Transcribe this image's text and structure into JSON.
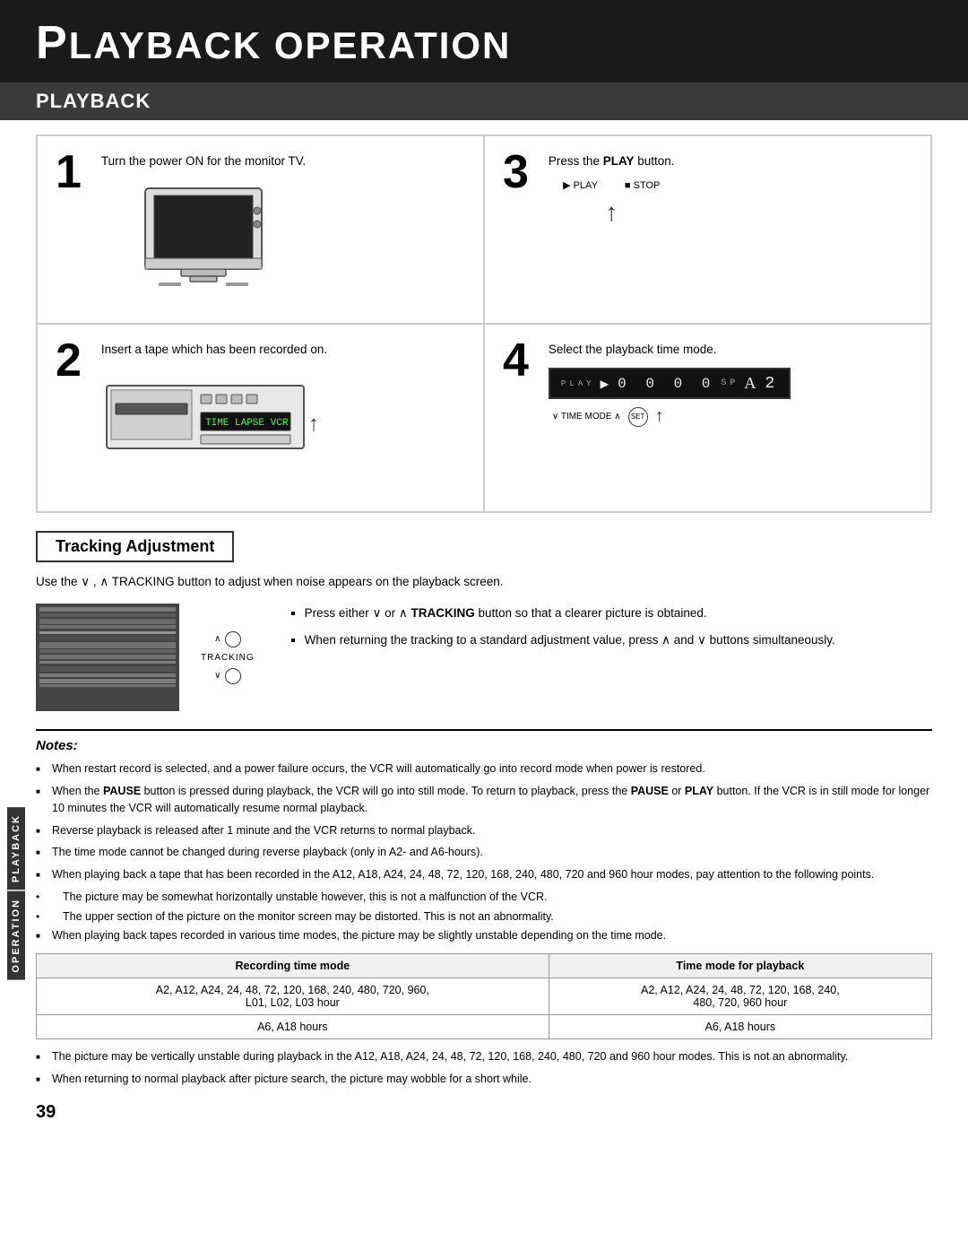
{
  "page": {
    "header_title": "LAYBACK OPERATION",
    "header_first_letter": "P",
    "section_title": "PLAYBACK",
    "page_number": "39"
  },
  "steps": [
    {
      "number": "1",
      "text": "Turn the power ON for the monitor TV.",
      "illustration_type": "tv"
    },
    {
      "number": "3",
      "text_prefix": "Press the ",
      "text_bold": "PLAY",
      "text_suffix": " button.",
      "illustration_type": "play_buttons"
    },
    {
      "number": "2",
      "text": "Insert a tape which has been recorded on.",
      "illustration_type": "vcr"
    },
    {
      "number": "4",
      "text": "Select the playback time mode.",
      "illustration_type": "time_mode"
    }
  ],
  "tracking_adjustment": {
    "title": "Tracking Adjustment",
    "description": "Use the ∨ , ∧ TRACKING button to adjust when noise appears on the playback screen.",
    "notes": [
      "Press either ∨ or ∧ TRACKING button so that a clearer picture is obtained.",
      "When returning the tracking to a standard adjustment value, press ∧ and ∨ buttons simultaneously."
    ],
    "knob_label": "TRACKING"
  },
  "notes_section": {
    "title": "Notes:",
    "items": [
      "When restart record is selected, and a power failure occurs, the VCR will automatically go into record mode when power is restored.",
      "When the PAUSE button is pressed during playback, the VCR will go into still mode. To return to playback, press the PAUSE or PLAY button. If the VCR is in still mode for longer 10 minutes the VCR will automatically resume normal playback.",
      "Reverse playback is released after 1 minute and the VCR returns to normal playback.",
      "The time mode cannot be changed during reverse playback (only in A2- and A6-hours).",
      "When playing back a tape that has been recorded in the A12, A18, A24, 24, 48, 72, 120, 168, 240, 480, 720 and 960 hour modes, pay attention to the following points.",
      "The picture may be somewhat horizontally unstable however, this is not a malfunction of the VCR.",
      "The upper section of the picture on the monitor screen may be distorted. This is not an abnormality.",
      "When playing back tapes recorded in various time modes, the picture may be slightly unstable depending on the time mode.",
      "The picture may be vertically unstable during playback in the A12, A18, A24, 24, 48, 72, 120, 168, 240, 480, 720 and 960 hour modes. This is not an abnormality.",
      "When returning to normal playback after picture search, the picture may wobble for a short while."
    ]
  },
  "table": {
    "col1_header": "Recording time mode",
    "col2_header": "Time mode for playback",
    "rows": [
      {
        "col1": "A2, A12, A24, 24, 48, 72, 120, 168, 240, 480, 720, 960,\nL01, L02, L03 hour",
        "col2": "A2, A12, A24, 24, 48, 72, 120, 168, 240,\n480, 720, 960 hour"
      },
      {
        "col1": "A6, A18 hours",
        "col2": "A6, A18 hours"
      }
    ]
  },
  "sidebar": {
    "line1": "PLAYBACK",
    "line2": "OPERATION"
  }
}
